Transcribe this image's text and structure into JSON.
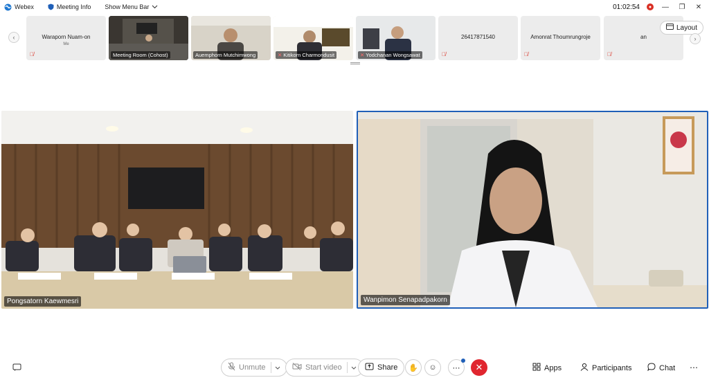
{
  "titlebar": {
    "app_name": "Webex",
    "meeting_info": "Meeting Info",
    "menu_bar": "Show Menu Bar",
    "timer": "01:02:54",
    "recording_indicator": "recording-icon"
  },
  "filmstrip": {
    "layout_label": "Layout",
    "tiles": [
      {
        "name": "Waraporn Nuam-on",
        "sub": "Me",
        "video": false,
        "muted": true
      },
      {
        "name": "Meeting Room (Cohost)",
        "video": true,
        "muted": false
      },
      {
        "name": "Auemphorn Mutchimwong",
        "video": true,
        "muted": false
      },
      {
        "name": "Kitikorn Charmondusit",
        "video": true,
        "muted": true
      },
      {
        "name": "Yodchanan Wongsawat",
        "video": true,
        "muted": true
      },
      {
        "name": "26417871540",
        "video": false,
        "muted": true
      },
      {
        "name": "Amonrat Thoumrungroje",
        "video": false,
        "muted": true
      },
      {
        "name": "an",
        "video": false,
        "muted": true
      }
    ]
  },
  "main": {
    "left_video_name": "Pongsatorn Kaewmesri",
    "right_video_name": "Wanpimon Senapadpakorn"
  },
  "toolbar": {
    "unmute": "Unmute",
    "start_video": "Start video",
    "share": "Share",
    "apps": "Apps",
    "participants": "Participants",
    "chat": "Chat"
  },
  "colors": {
    "active_border": "#1f5fb8",
    "leave_button": "#e0262f",
    "muted_icon": "#d93025"
  }
}
